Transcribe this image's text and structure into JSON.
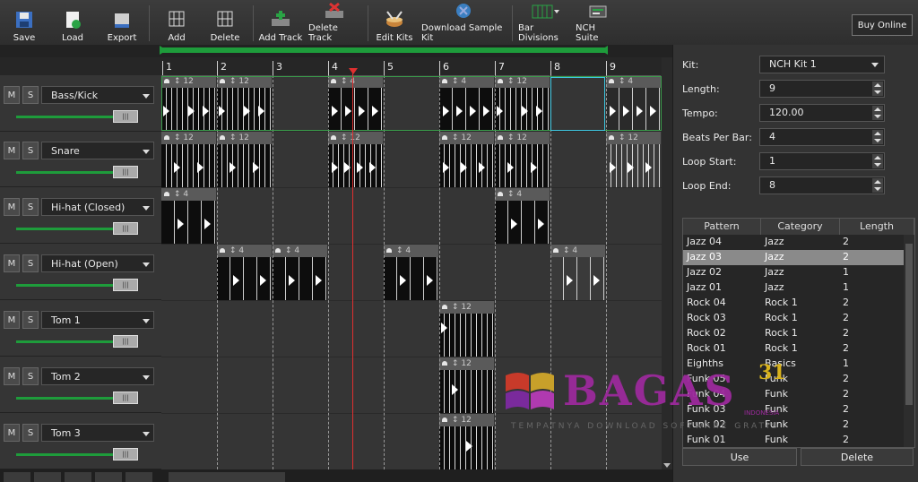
{
  "toolbar": {
    "save": "Save",
    "load": "Load",
    "export": "Export",
    "add": "Add",
    "delete": "Delete",
    "add_track": "Add Track",
    "delete_track": "Delete Track",
    "edit_kits": "Edit Kits",
    "download_sample_kit": "Download Sample Kit",
    "bar_divisions": "Bar Divisions",
    "nch_suite": "NCH Suite",
    "buy_online": "Buy Online"
  },
  "bars": [
    "1",
    "2",
    "3",
    "4",
    "5",
    "6",
    "7",
    "8",
    "9"
  ],
  "tracks": [
    {
      "mute": "M",
      "solo": "S",
      "name": "Bass/Kick"
    },
    {
      "mute": "M",
      "solo": "S",
      "name": "Snare"
    },
    {
      "mute": "M",
      "solo": "S",
      "name": "Hi-hat (Closed)"
    },
    {
      "mute": "M",
      "solo": "S",
      "name": "Hi-hat (Open)"
    },
    {
      "mute": "M",
      "solo": "S",
      "name": "Tom 1"
    },
    {
      "mute": "M",
      "solo": "S",
      "name": "Tom 2"
    },
    {
      "mute": "M",
      "solo": "S",
      "name": "Tom 3"
    }
  ],
  "patterns": {
    "count_12": "12",
    "count_4": "4"
  },
  "properties": {
    "kit_label": "Kit:",
    "kit_value": "NCH Kit 1",
    "length_label": "Length:",
    "length_value": "9",
    "tempo_label": "Tempo:",
    "tempo_value": "120.00",
    "bpb_label": "Beats Per Bar:",
    "bpb_value": "4",
    "loop_start_label": "Loop Start:",
    "loop_start_value": "1",
    "loop_end_label": "Loop End:",
    "loop_end_value": "8"
  },
  "pattern_table": {
    "headers": [
      "Pattern",
      "Category",
      "Length"
    ],
    "rows": [
      [
        "Jazz 04",
        "Jazz",
        "2"
      ],
      [
        "Jazz 03",
        "Jazz",
        "2"
      ],
      [
        "Jazz 02",
        "Jazz",
        "1"
      ],
      [
        "Jazz 01",
        "Jazz",
        "1"
      ],
      [
        "Rock 04",
        "Rock 1",
        "2"
      ],
      [
        "Rock 03",
        "Rock 1",
        "2"
      ],
      [
        "Rock 02",
        "Rock 1",
        "2"
      ],
      [
        "Rock 01",
        "Rock 1",
        "2"
      ],
      [
        "Eighths",
        "Basics",
        "1"
      ],
      [
        "Funk 05",
        "Funk",
        "2"
      ],
      [
        "Funk 04",
        "Funk",
        "2"
      ],
      [
        "Funk 03",
        "Funk",
        "2"
      ],
      [
        "Funk 02",
        "Funk",
        "2"
      ],
      [
        "Funk 01",
        "Funk",
        "2"
      ]
    ],
    "selected_index": 1
  },
  "buttons": {
    "use": "Use",
    "delete": "Delete"
  },
  "watermark": {
    "text": "BAGAS",
    "number": "31",
    "small": "INDONESIA",
    "sub": "TEMPATNYA DOWNLOAD SOFTWARE GRATIS"
  },
  "colors": {
    "accent_green": "#1e9c3b",
    "playhead": "#e03030",
    "selection": "#3ec6e0",
    "watermark": "#9c2a9c"
  }
}
